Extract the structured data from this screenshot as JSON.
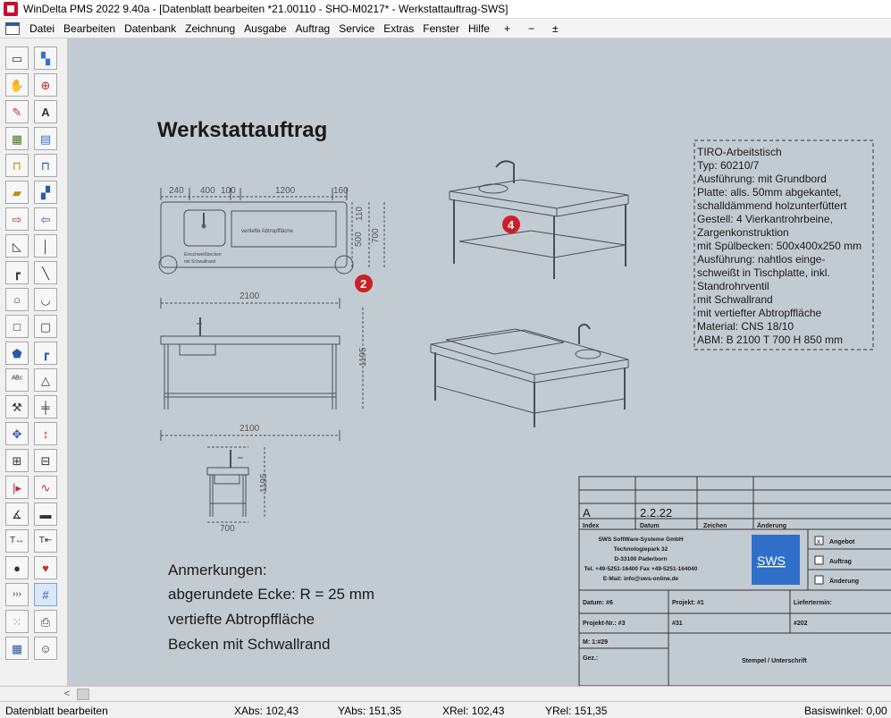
{
  "window": {
    "title": "WinDelta PMS 2022 9.40a - [Datenblatt bearbeiten *21.00110 - SHO-M0217* - Werkstattauftrag-SWS]"
  },
  "menu": {
    "items": [
      "Datei",
      "Bearbeiten",
      "Datenbank",
      "Zeichnung",
      "Ausgabe",
      "Auftrag",
      "Service",
      "Extras",
      "Fenster",
      "Hilfe",
      "+",
      "−",
      "±"
    ]
  },
  "toolbar": {
    "tools": [
      "select-window",
      "image-tool",
      "pan-hand",
      "zoom",
      "pen-color",
      "text-tool",
      "fill-tool",
      "hatch-tool",
      "dim-h-yellow",
      "dim-h-blue",
      "folder-insert",
      "layer-tool",
      "move-red",
      "move-blue",
      "angle-line",
      "vertical-line",
      "corner-line",
      "diagonal-line",
      "circle",
      "arc",
      "rectangle",
      "rounded-rectangle",
      "polygon-fill",
      "corner-tool",
      "spell-check",
      "triangle",
      "hammer",
      "parallel-lines",
      "move-cross",
      "vertical-arrow",
      "dimension-tool",
      "dimension-tool-2",
      "align-red",
      "wave-tool",
      "angle-tool",
      "scale-bar",
      "text-size",
      "text-size-2",
      "bomb",
      "heart",
      "arrows-right",
      "grid-toggle",
      "dots-grid",
      "printer",
      "calendar",
      "smiley"
    ]
  },
  "drawing": {
    "title": "Werkstattauftrag",
    "dims_top": [
      "240",
      "400",
      "100",
      "1200",
      "160"
    ],
    "dims_right": [
      "110",
      "500",
      "700"
    ],
    "label_recess": "vertiefte Abtropffläche",
    "label_sink": [
      "Einschweißbecken",
      "mit Schwallrand"
    ],
    "dim_2100": "2100",
    "dim_1195": "1195",
    "dim_700": "700",
    "marker_2": "2",
    "marker_4": "4",
    "spec_lines": [
      "TIRO-Arbeitstisch",
      "Typ: 60210/7",
      "Ausführung: mit Grundbord",
      "Platte: alls. 50mm abgekantet,",
      "schalldämmend holzunterfüttert",
      "Gestell: 4 Vierkantrohrbeine,",
      "Zargenkonstruktion",
      "mit Spülbecken: 500x400x250 mm",
      "Ausführung: nahtlos einge-",
      "schweißt in Tischplatte, inkl.",
      "Standrohrventil",
      "mit Schwallrand",
      "mit vertiefter Abtropffläche",
      "Material: CNS 18/10",
      "ABM: B 2100 T 700 H 850 mm"
    ],
    "notes_heading": "Anmerkungen:",
    "notes": [
      "abgerundete Ecke: R = 25 mm",
      "vertiefte Abtropffläche",
      "Becken mit Schwallrand"
    ]
  },
  "title_block": {
    "rev_index": "A",
    "rev_date": "2.2.22",
    "header_index": "Index",
    "header_datum": "Datum",
    "header_zeichen": "Zeichen",
    "header_aenderung": "Änderung",
    "company": [
      "SWS SoftWare-Systeme GmbH",
      "Technologiepark 32",
      "D-33100 Paderborn",
      "Tel. +49-5251-16400 Fax +49-5251-164040",
      "E-Mail: info@sws-online.de"
    ],
    "logo_text": "SWS",
    "checkbox_angebot": "Angebot",
    "checkbox_auftrag": "Auftrag",
    "checkbox_aenderung": "Änderung",
    "angebot_marker": "x",
    "datum": "Datum: #6",
    "projekt": "Projekt: #1",
    "liefertermin": "Liefertermin:",
    "projekt_nr": "Projekt-Nr.: #3",
    "projekt_nr_val": "#31",
    "liefertermin_val": "#202",
    "massstab": "M: 1:#29",
    "gez": "Gez.:",
    "stempel": "Stempel / Unterschrift"
  },
  "statusbar": {
    "mode": "Datenblatt bearbeiten",
    "xabs": "XAbs: 102,43",
    "yabs": "YAbs: 151,35",
    "xrel": "XRel: 102,43",
    "yrel": "YRel: 151,35",
    "basiswinkel": "Basiswinkel: 0,00"
  },
  "colors": {
    "canvas": "#c3cbd2",
    "marker": "#cc2027",
    "logo": "#2f6fc9",
    "line": "#4a4f55"
  }
}
